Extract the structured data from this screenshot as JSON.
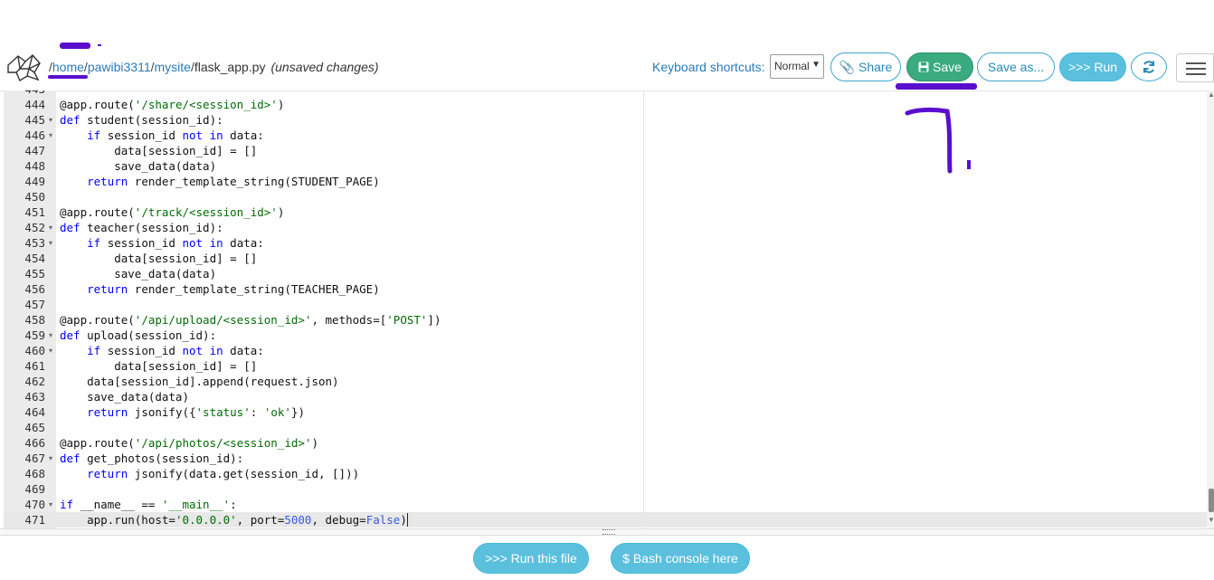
{
  "header": {
    "path_segments": [
      "home",
      "pawibi3311",
      "mysite"
    ],
    "path_separator": "/",
    "filename": "flask_app.py",
    "unsaved_text": "(unsaved changes)",
    "shortcuts_label": "Keyboard shortcuts:",
    "shortcuts_mode": "Normal",
    "share_label": "Share",
    "save_label": "Save",
    "save_as_label": "Save as...",
    "run_label": ">>> Run"
  },
  "annotation": {
    "text": "7."
  },
  "editor": {
    "active_line": 471,
    "lines": [
      {
        "n": 444,
        "fold": false
      },
      {
        "n": 445,
        "fold": true
      },
      {
        "n": 446,
        "fold": true
      },
      {
        "n": 447,
        "fold": false
      },
      {
        "n": 448,
        "fold": false
      },
      {
        "n": 449,
        "fold": false
      },
      {
        "n": 450,
        "fold": false
      },
      {
        "n": 451,
        "fold": false
      },
      {
        "n": 452,
        "fold": true
      },
      {
        "n": 453,
        "fold": true
      },
      {
        "n": 454,
        "fold": false
      },
      {
        "n": 455,
        "fold": false
      },
      {
        "n": 456,
        "fold": false
      },
      {
        "n": 457,
        "fold": false
      },
      {
        "n": 458,
        "fold": false
      },
      {
        "n": 459,
        "fold": true
      },
      {
        "n": 460,
        "fold": true
      },
      {
        "n": 461,
        "fold": false
      },
      {
        "n": 462,
        "fold": false
      },
      {
        "n": 463,
        "fold": false
      },
      {
        "n": 464,
        "fold": false
      },
      {
        "n": 465,
        "fold": false
      },
      {
        "n": 466,
        "fold": false
      },
      {
        "n": 467,
        "fold": true
      },
      {
        "n": 468,
        "fold": false
      },
      {
        "n": 469,
        "fold": false
      },
      {
        "n": 470,
        "fold": true
      },
      {
        "n": 471,
        "fold": false
      }
    ],
    "code": [
      [
        [
          "t",
          "@app.route("
        ],
        [
          "s",
          "'/share/<session_id>'"
        ],
        [
          "t",
          ")"
        ]
      ],
      [
        [
          "k",
          "def"
        ],
        [
          "t",
          " student(session_id):"
        ]
      ],
      [
        [
          "t",
          "    "
        ],
        [
          "k",
          "if"
        ],
        [
          "t",
          " session_id "
        ],
        [
          "k",
          "not"
        ],
        [
          "t",
          " "
        ],
        [
          "k",
          "in"
        ],
        [
          "t",
          " data:"
        ]
      ],
      [
        [
          "t",
          "        data[session_id] = []"
        ]
      ],
      [
        [
          "t",
          "        save_data(data)"
        ]
      ],
      [
        [
          "t",
          "    "
        ],
        [
          "k",
          "return"
        ],
        [
          "t",
          " render_template_string(STUDENT_PAGE)"
        ]
      ],
      [],
      [
        [
          "t",
          "@app.route("
        ],
        [
          "s",
          "'/track/<session_id>'"
        ],
        [
          "t",
          ")"
        ]
      ],
      [
        [
          "k",
          "def"
        ],
        [
          "t",
          " teacher(session_id):"
        ]
      ],
      [
        [
          "t",
          "    "
        ],
        [
          "k",
          "if"
        ],
        [
          "t",
          " session_id "
        ],
        [
          "k",
          "not"
        ],
        [
          "t",
          " "
        ],
        [
          "k",
          "in"
        ],
        [
          "t",
          " data:"
        ]
      ],
      [
        [
          "t",
          "        data[session_id] = []"
        ]
      ],
      [
        [
          "t",
          "        save_data(data)"
        ]
      ],
      [
        [
          "t",
          "    "
        ],
        [
          "k",
          "return"
        ],
        [
          "t",
          " render_template_string(TEACHER_PAGE)"
        ]
      ],
      [],
      [
        [
          "t",
          "@app.route("
        ],
        [
          "s",
          "'/api/upload/<session_id>'"
        ],
        [
          "t",
          ", methods=["
        ],
        [
          "s",
          "'POST'"
        ],
        [
          "t",
          "])"
        ]
      ],
      [
        [
          "k",
          "def"
        ],
        [
          "t",
          " upload(session_id):"
        ]
      ],
      [
        [
          "t",
          "    "
        ],
        [
          "k",
          "if"
        ],
        [
          "t",
          " session_id "
        ],
        [
          "k",
          "not"
        ],
        [
          "t",
          " "
        ],
        [
          "k",
          "in"
        ],
        [
          "t",
          " data:"
        ]
      ],
      [
        [
          "t",
          "        data[session_id] = []"
        ]
      ],
      [
        [
          "t",
          "    data[session_id].append(request.json)"
        ]
      ],
      [
        [
          "t",
          "    save_data(data)"
        ]
      ],
      [
        [
          "t",
          "    "
        ],
        [
          "k",
          "return"
        ],
        [
          "t",
          " jsonify({"
        ],
        [
          "s",
          "'status'"
        ],
        [
          "t",
          ": "
        ],
        [
          "s",
          "'ok'"
        ],
        [
          "t",
          "})"
        ]
      ],
      [],
      [
        [
          "t",
          "@app.route("
        ],
        [
          "s",
          "'/api/photos/<session_id>'"
        ],
        [
          "t",
          ")"
        ]
      ],
      [
        [
          "k",
          "def"
        ],
        [
          "t",
          " get_photos(session_id):"
        ]
      ],
      [
        [
          "t",
          "    "
        ],
        [
          "k",
          "return"
        ],
        [
          "t",
          " jsonify(data.get(session_id, []))"
        ]
      ],
      [],
      [
        [
          "k",
          "if"
        ],
        [
          "t",
          " __name__ == "
        ],
        [
          "s",
          "'__main__'"
        ],
        [
          "t",
          ":"
        ]
      ],
      [
        [
          "t",
          "    app.run(host="
        ],
        [
          "s",
          "'0.0.0.0'"
        ],
        [
          "t",
          ", port="
        ],
        [
          "c",
          "5000"
        ],
        [
          "t",
          ", debug="
        ],
        [
          "c",
          "False"
        ],
        [
          "t",
          ")"
        ]
      ]
    ]
  },
  "footer": {
    "run_file_label": ">>> Run this file",
    "bash_label": "$ Bash console here"
  }
}
